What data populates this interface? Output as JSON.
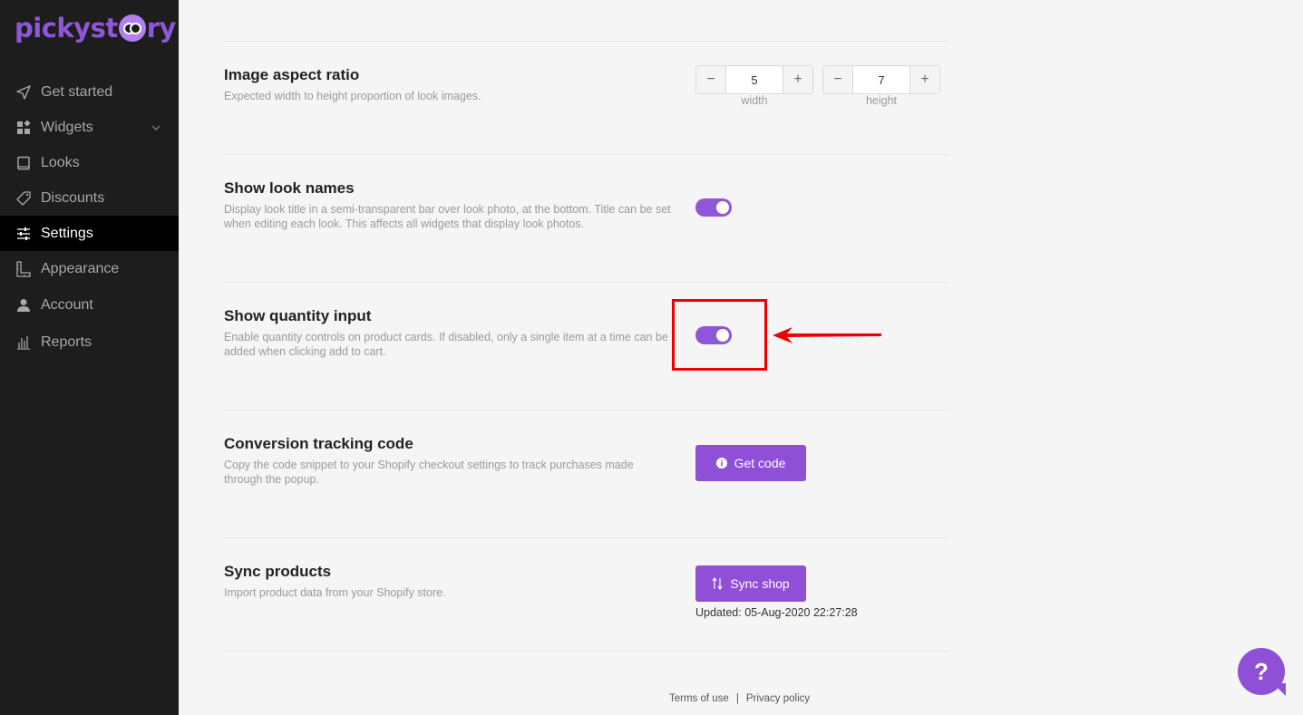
{
  "brand": {
    "name_part1": "pickyst",
    "name_part2": "ry",
    "accent": "#8f57d8"
  },
  "sidebar": {
    "items": [
      {
        "label": "Get started",
        "icon": "send-icon"
      },
      {
        "label": "Widgets",
        "icon": "widgets-icon"
      },
      {
        "label": "Looks",
        "icon": "book-icon"
      },
      {
        "label": "Discounts",
        "icon": "tag-icon"
      },
      {
        "label": "Settings",
        "icon": "sliders-icon",
        "active": true
      },
      {
        "label": "Appearance",
        "icon": "ruler-icon"
      },
      {
        "label": "Account",
        "icon": "user-icon"
      },
      {
        "label": "Reports",
        "icon": "bar-chart-icon"
      }
    ]
  },
  "settings": {
    "aspect": {
      "title": "Image aspect ratio",
      "desc": "Expected width to height proportion of look images.",
      "width_value": "5",
      "width_label": "width",
      "height_value": "7",
      "height_label": "height",
      "minus": "−",
      "plus": "+"
    },
    "look_names": {
      "title": "Show look names",
      "desc": "Display look title in a semi-transparent bar over look photo, at the bottom. Title can be set when editing each look. This affects all widgets that display look photos.",
      "enabled": true
    },
    "quantity": {
      "title": "Show quantity input",
      "desc": "Enable quantity controls on product cards. If disabled, only a single item at a time can be added when clicking add to cart.",
      "enabled": true
    },
    "conversion": {
      "title": "Conversion tracking code",
      "desc": "Copy the code snippet to your Shopify checkout settings to track purchases made through the popup.",
      "button": "Get code"
    },
    "sync": {
      "title": "Sync products",
      "desc": "Import product data from your Shopify store.",
      "button": "Sync shop",
      "updated": "Updated: 05-Aug-2020 22:27:28"
    }
  },
  "footer": {
    "terms": "Terms of use",
    "separator": "|",
    "privacy": "Privacy policy"
  },
  "help": {
    "label": "?"
  }
}
